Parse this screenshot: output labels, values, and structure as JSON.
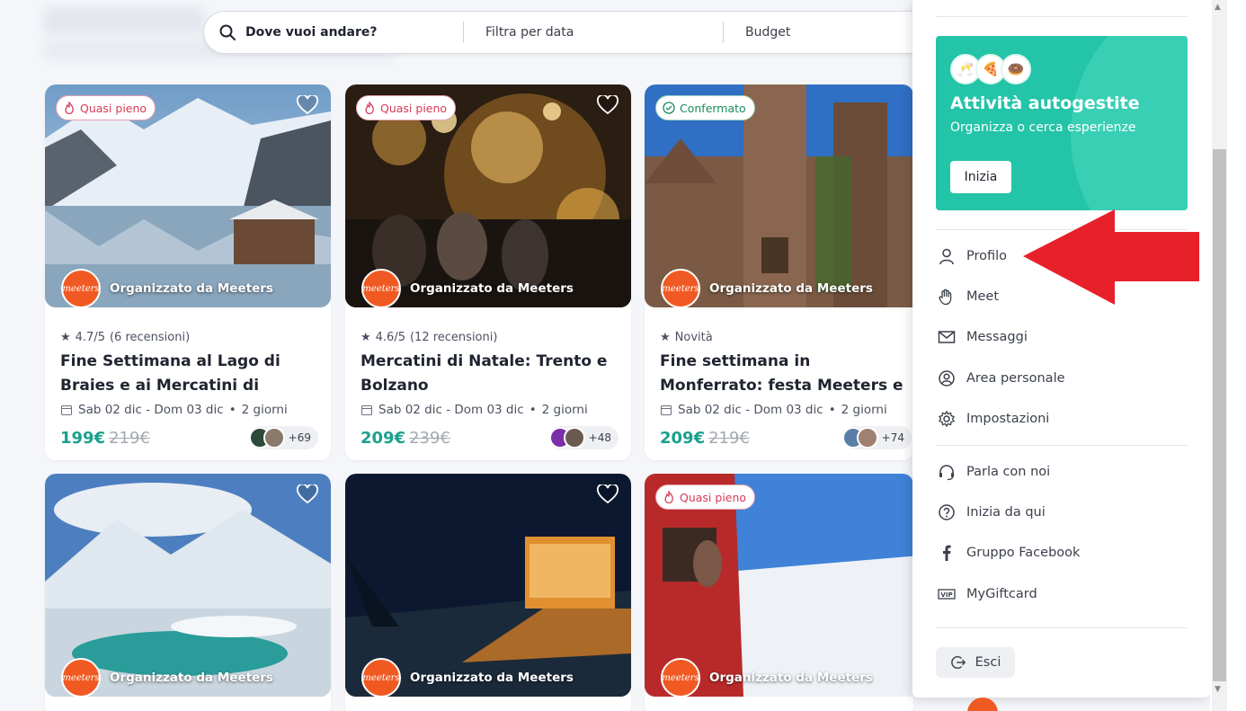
{
  "search": {
    "where": "Dove vuoi andare?",
    "date": "Filtra per data",
    "budget": "Budget"
  },
  "cards": [
    {
      "badge": "Quasi pieno",
      "organizer": "Organizzato da Meeters",
      "rating": "4.7/5",
      "reviews": "(6 recensioni)",
      "title": "Fine Settimana al Lago di Braies e ai Mercatini di Natale",
      "dates": "Sab 02 dic - Dom 03 dic",
      "duration": "2 giorni",
      "price": "199€",
      "old_price": "219€",
      "more": "+69"
    },
    {
      "badge": "Quasi pieno",
      "organizer": "Organizzato da Meeters",
      "rating": "4.6/5",
      "reviews": "(12 recensioni)",
      "title": "Mercatini di Natale: Trento e Bolzano",
      "dates": "Sab 02 dic - Dom 03 dic",
      "duration": "2 giorni",
      "price": "209€",
      "old_price": "239€",
      "more": "+48"
    },
    {
      "badge": "Confermato",
      "organizer": "Organizzato da Meeters",
      "rating": "Novità",
      "reviews": "",
      "title": "Fine settimana in Monferrato: festa Meeters e degustazione…",
      "dates": "Sab 02 dic - Dom 03 dic",
      "duration": "2 giorni",
      "price": "209€",
      "old_price": "219€",
      "more": "+74"
    },
    {
      "badge": "",
      "organizer": "Organizzato da Meeters"
    },
    {
      "badge": "",
      "organizer": "Organizzato da Meeters"
    },
    {
      "badge": "Quasi pieno",
      "organizer": "Organizzato da Meeters"
    }
  ],
  "logo_text": "meeters",
  "menu": {
    "promo": {
      "title": "Attività autogestite",
      "subtitle": "Organizza o cerca esperienze",
      "button": "Inizia"
    },
    "items": [
      "Profilo",
      "Meet",
      "Messaggi",
      "Area personale",
      "Impostazioni"
    ],
    "items2": [
      "Parla con noi",
      "Inizia da qui",
      "Gruppo Facebook",
      "MyGiftcard"
    ],
    "logout": "Esci"
  },
  "colors": {
    "accent": "#1aa08e",
    "promo": "#23c4a8",
    "orange": "#f05a22",
    "arrow": "#e8202a"
  }
}
